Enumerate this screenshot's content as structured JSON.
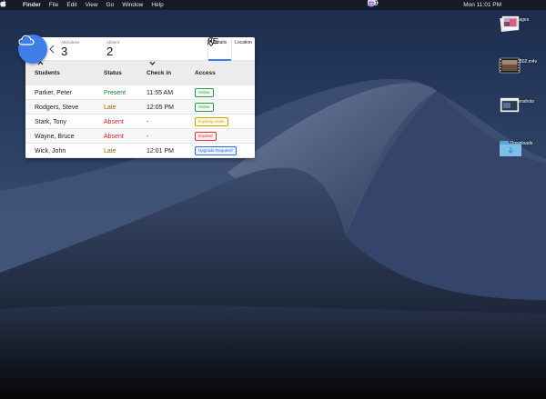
{
  "menubar": {
    "items": [
      "Finder",
      "File",
      "Edit",
      "View",
      "Go",
      "Window",
      "Help"
    ],
    "clock": "Mon 11:01 PM"
  },
  "desktop": {
    "icons": [
      {
        "label": "Images",
        "icon": "images-folder-icon"
      },
      {
        "label": "IMG_1802.m4v",
        "icon": "video-file-icon"
      },
      {
        "label": "Screenshots",
        "icon": "screenshots-folder-icon"
      },
      {
        "label": "Downloads",
        "icon": "folder-icon"
      }
    ]
  },
  "panel": {
    "stats": {
      "attendees_label": "Attendees",
      "attendees_value": "3",
      "absent_label": "Absent",
      "absent_value": "2"
    },
    "tabs": [
      {
        "label": "Details",
        "icon": "details-list-icon",
        "active": true
      },
      {
        "label": "Location",
        "icon": "location-pin-icon",
        "active": false
      }
    ],
    "columns": {
      "students": "Students",
      "status": "Status",
      "checkin": "Check in",
      "access": "Access"
    },
    "rows": [
      {
        "name": "Parker, Peter",
        "status": "Present",
        "checkin": "11:55 AM",
        "access": "Active",
        "status_color": "#1e7e34",
        "access_kind": "green"
      },
      {
        "name": "Rodgers, Steve",
        "status": "Late",
        "checkin": "12:05 PM",
        "access": "Active",
        "status_color": "#9a6700",
        "access_kind": "green"
      },
      {
        "name": "Stark, Tony",
        "status": "Absent",
        "checkin": "-",
        "access": "Expiring Soon",
        "status_color": "#c62828",
        "access_kind": "yellow"
      },
      {
        "name": "Wayne, Bruce",
        "status": "Absent",
        "checkin": "-",
        "access": "Expired",
        "status_color": "#c62828",
        "access_kind": "red"
      },
      {
        "name": "Wick, John",
        "status": "Late",
        "checkin": "12:01 PM",
        "access": "Upgrade Required",
        "status_color": "#9a6700",
        "access_kind": "blue"
      }
    ]
  },
  "colors": {
    "accent": "#3e7ee6",
    "badge_green": "#2e9a48",
    "badge_yellow": "#c9a400",
    "badge_red": "#d43a3a",
    "badge_blue": "#2f6fd0"
  }
}
